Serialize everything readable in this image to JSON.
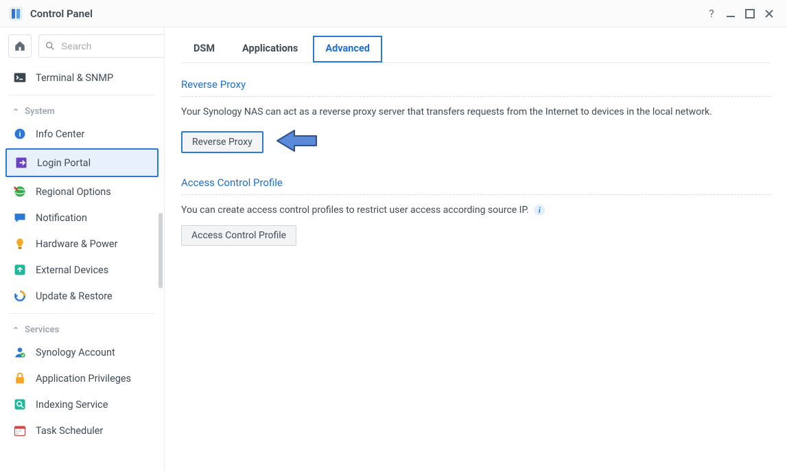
{
  "window": {
    "title": "Control Panel"
  },
  "search": {
    "placeholder": "Search"
  },
  "sidebar": {
    "top": [
      {
        "label": "Terminal & SNMP"
      }
    ],
    "groups": [
      {
        "name": "System",
        "items": [
          {
            "label": "Info Center"
          },
          {
            "label": "Login Portal",
            "selected": true
          },
          {
            "label": "Regional Options"
          },
          {
            "label": "Notification"
          },
          {
            "label": "Hardware & Power"
          },
          {
            "label": "External Devices"
          },
          {
            "label": "Update & Restore"
          }
        ]
      },
      {
        "name": "Services",
        "items": [
          {
            "label": "Synology Account"
          },
          {
            "label": "Application Privileges"
          },
          {
            "label": "Indexing Service"
          },
          {
            "label": "Task Scheduler"
          }
        ]
      }
    ]
  },
  "tabs": [
    {
      "label": "DSM"
    },
    {
      "label": "Applications"
    },
    {
      "label": "Advanced",
      "active": true
    }
  ],
  "sections": {
    "reverse_proxy": {
      "title": "Reverse Proxy",
      "desc": "Your Synology NAS can act as a reverse proxy server that transfers requests from the Internet to devices in the local network.",
      "button": "Reverse Proxy"
    },
    "acp": {
      "title": "Access Control Profile",
      "desc": "You can create access control profiles to restrict user access according source IP.",
      "button": "Access Control Profile"
    }
  }
}
